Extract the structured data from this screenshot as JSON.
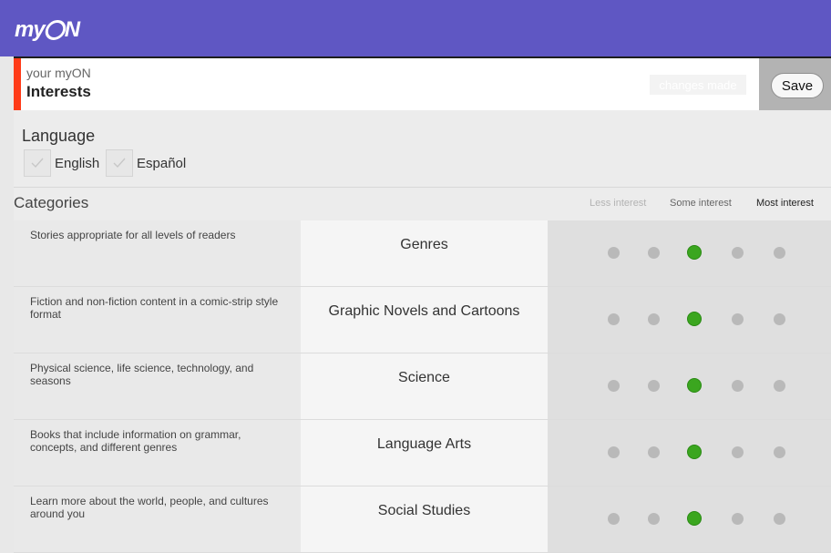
{
  "app": {
    "logo_text": "myON",
    "header_subtitle": "your myON",
    "header_title": "Interests",
    "changes_made": "changes made",
    "save_label": "Save"
  },
  "language": {
    "label": "Language",
    "options": [
      {
        "label": "English",
        "checked": false
      },
      {
        "label": "Español",
        "checked": false
      }
    ]
  },
  "categories": {
    "heading": "Categories",
    "scale_labels": [
      "Less interest",
      "Some interest",
      "Most interest"
    ],
    "rows": [
      {
        "description": "Stories appropriate for all levels of readers",
        "name": "Genres",
        "interest_level": 3
      },
      {
        "description": "Fiction and non-fiction content in a comic-strip style format",
        "name": "Graphic Novels and Cartoons",
        "interest_level": 3
      },
      {
        "description": "Physical science, life science, technology, and seasons",
        "name": "Science",
        "interest_level": 3
      },
      {
        "description": "Books that include information on grammar, concepts, and different genres",
        "name": "Language Arts",
        "interest_level": 3
      },
      {
        "description": "Learn more about the world, people, and cultures around you",
        "name": "Social Studies",
        "interest_level": 3
      }
    ]
  },
  "colors": {
    "topbar": "#5f57c3",
    "accent": "#ff3b18",
    "selected_dot": "#3ba61f",
    "unselected_dot": "#b9b9b9"
  },
  "icons": {
    "checkbox": "check-icon"
  }
}
